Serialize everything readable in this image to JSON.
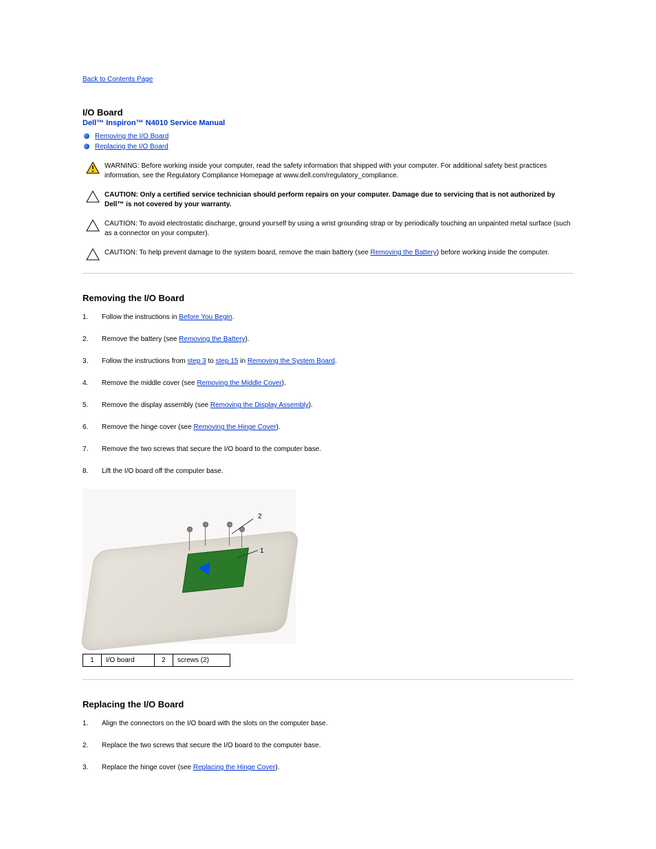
{
  "back_link": "Back to Contents Page",
  "title": "I/O Board",
  "subtitle": "Dell™ Inspiron™ N4010 Service Manual",
  "toc": [
    "Removing the I/O Board",
    "Replacing the I/O Board"
  ],
  "notices": {
    "warning": {
      "lead": "WARNING: Before working inside your computer, read the safety information that shipped with your computer. For additional safety best practices information, see the Regulatory Compliance Homepage at www.dell.com/regulatory_compliance."
    },
    "caution1": {
      "lead": "CAUTION:",
      "text": " Only a certified service technician should perform repairs on your computer. Damage due to servicing that is not authorized by Dell™ is not covered by your warranty."
    },
    "caution2": {
      "lead": "CAUTION: To avoid electrostatic discharge, ground yourself by using a wrist grounding strap or by periodically touching an unpainted metal surface (such as a connector on your computer)."
    },
    "caution3": {
      "lead": "CAUTION: To help prevent damage to the system board, remove the main battery (see ",
      "link": "Removing the Battery",
      "tail": ") before working inside the computer."
    }
  },
  "section1": {
    "heading": "Removing the I/O Board",
    "steps": [
      {
        "text": "Follow the instructions in ",
        "link": "Before You Begin",
        "tail": "."
      },
      {
        "text": "Remove the battery (see ",
        "link": "Removing the Battery",
        "tail": ")."
      },
      {
        "text": "Follow the instructions from ",
        "link": "step 3",
        "mid": " to ",
        "link2": "step 15",
        "mid2": " in ",
        "link3": "Removing the System Board",
        "tail": "."
      },
      {
        "text": "Remove the middle cover (see ",
        "link": "Removing the Middle Cover",
        "tail": ")."
      },
      {
        "text": "Remove the display assembly (see ",
        "link": "Removing the Display Assembly",
        "tail": ")."
      },
      {
        "text": "Remove the hinge cover (see ",
        "link": "Removing the Hinge Cover",
        "tail": ")."
      },
      {
        "text": "Remove the two screws that secure the I/O board to the computer base."
      },
      {
        "text": "Lift the I/O board off the computer base."
      }
    ]
  },
  "callouts": {
    "c1": "1",
    "c2": "2"
  },
  "parts": {
    "r1n": "1",
    "r1t": "I/O board",
    "r2n": "2",
    "r2t": "screws (2)"
  },
  "section2": {
    "heading": "Replacing the I/O Board",
    "steps": [
      {
        "text": "Align the connectors on the I/O board with the slots on the computer base."
      },
      {
        "text": "Replace the two screws that secure the I/O board to the computer base."
      },
      {
        "text": "Replace the hinge cover (see ",
        "link": "Replacing the Hinge Cover",
        "tail": ")."
      }
    ]
  }
}
